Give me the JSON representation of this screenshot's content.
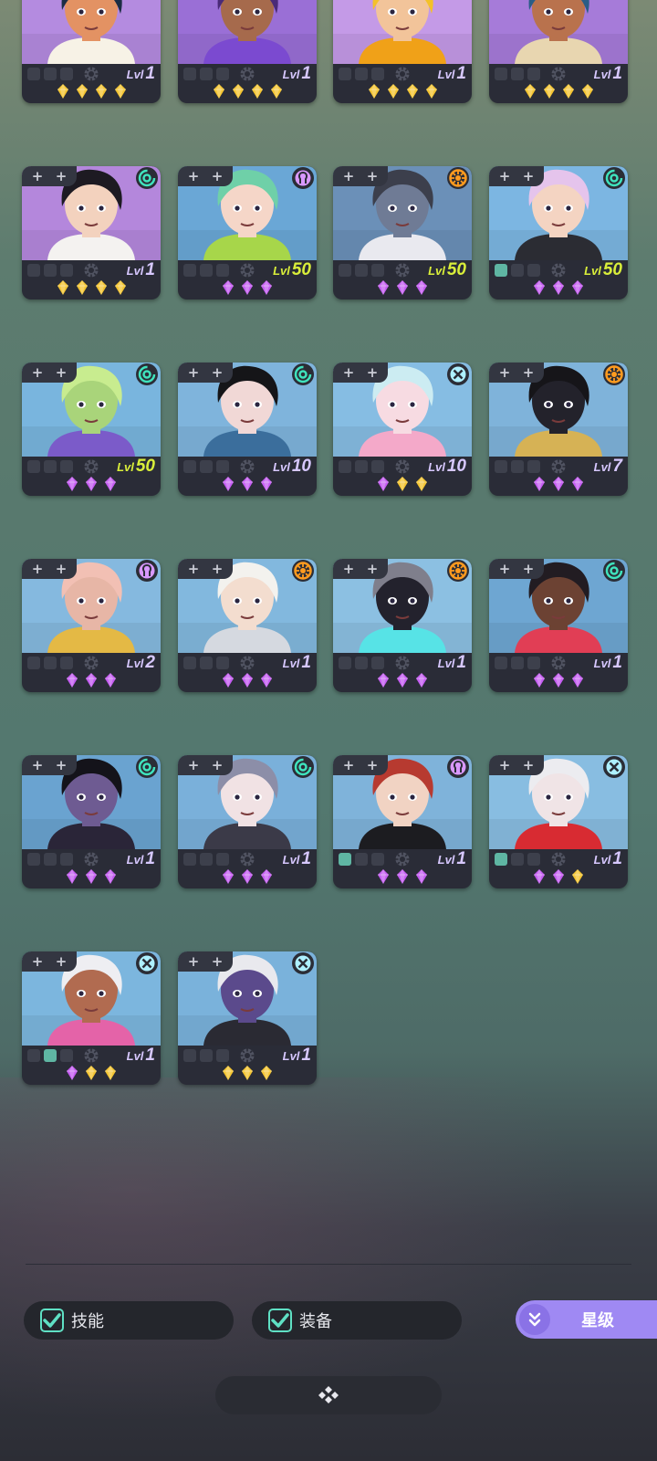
{
  "roster": {
    "heroes": [
      {
        "portrait": "hero-1",
        "bg": "#b48be0",
        "skin": "#e39263",
        "hair": "#1c2d44",
        "accent": "#f7f2e6",
        "slots": [
          false,
          false,
          false
        ],
        "level": "1",
        "elementIcon": "",
        "stars": [
          "gold",
          "gold",
          "gold",
          "gold"
        ]
      },
      {
        "portrait": "hero-2",
        "bg": "#9a6fd6",
        "skin": "#a66a4c",
        "hair": "#4a2a78",
        "accent": "#7b4ad0",
        "slots": [
          false,
          false,
          false
        ],
        "level": "1",
        "elementIcon": "",
        "stars": [
          "gold",
          "gold",
          "gold",
          "gold"
        ]
      },
      {
        "portrait": "hero-3",
        "bg": "#c49ae7",
        "skin": "#f2c49a",
        "hair": "#f3c12a",
        "accent": "#f0a118",
        "slots": [
          false,
          false,
          false
        ],
        "level": "1",
        "elementIcon": "",
        "stars": [
          "gold",
          "gold",
          "gold",
          "gold"
        ]
      },
      {
        "portrait": "hero-4",
        "bg": "#a67bd9",
        "skin": "#b9724d",
        "hair": "#2a5d86",
        "accent": "#e8d6b0",
        "slots": [
          false,
          false,
          false
        ],
        "level": "1",
        "elementIcon": "",
        "stars": [
          "gold",
          "gold",
          "gold",
          "gold"
        ]
      },
      {
        "portrait": "hero-5",
        "bg": "#b487dc",
        "skin": "#f3d2be",
        "hair": "#1d1a22",
        "accent": "#f4f2f0",
        "slots": [
          false,
          false,
          false
        ],
        "level": "1",
        "elementIcon": "swirl-icon",
        "stars": [
          "gold",
          "gold",
          "gold",
          "gold"
        ]
      },
      {
        "portrait": "hero-6",
        "bg": "#6aa7d6",
        "skin": "#f5d6c8",
        "hair": "#6fd0a8",
        "accent": "#a7d64a",
        "slots": [
          false,
          false,
          false
        ],
        "level": "50",
        "elementIcon": "psychic-icon",
        "stars": [
          "purple",
          "purple",
          "purple"
        ]
      },
      {
        "portrait": "hero-7",
        "bg": "#6b90b8",
        "skin": "#6f7b95",
        "hair": "#3c3f4c",
        "accent": "#e9e9ef",
        "slots": [
          false,
          false,
          false
        ],
        "level": "50",
        "elementIcon": "sun-icon",
        "stars": [
          "purple",
          "purple",
          "purple"
        ]
      },
      {
        "portrait": "hero-8",
        "bg": "#7cb6e2",
        "skin": "#f4d4c2",
        "hair": "#e5c4ec",
        "accent": "#2b2c33",
        "slots": [
          true,
          false,
          false
        ],
        "level": "50",
        "elementIcon": "swirl-icon",
        "stars": [
          "purple",
          "purple",
          "purple"
        ]
      },
      {
        "portrait": "hero-9",
        "bg": "#79b5de",
        "skin": "#a9d47a",
        "hair": "#c8ec8f",
        "accent": "#7b5bc9",
        "slots": [
          false,
          false,
          false
        ],
        "level": "50",
        "elementIcon": "swirl-icon",
        "stars": [
          "purple",
          "purple",
          "purple"
        ]
      },
      {
        "portrait": "hero-10",
        "bg": "#7fb4dc",
        "skin": "#f1d8d6",
        "hair": "#151518",
        "accent": "#3b6e9c",
        "slots": [
          false,
          false,
          false
        ],
        "level": "10",
        "elementIcon": "swirl-icon",
        "stars": [
          "purple",
          "purple",
          "purple"
        ]
      },
      {
        "portrait": "hero-11",
        "bg": "#86bde3",
        "skin": "#f7dbe2",
        "hair": "#ccecf2",
        "accent": "#f4a9c9",
        "slots": [
          false,
          false,
          false
        ],
        "level": "10",
        "elementIcon": "cross-icon",
        "stars": [
          "purple",
          "gold",
          "gold"
        ]
      },
      {
        "portrait": "hero-12",
        "bg": "#7fb3da",
        "skin": "#23222b",
        "hair": "#161519",
        "accent": "#d6b255",
        "slots": [
          false,
          false,
          false
        ],
        "level": "7",
        "elementIcon": "sun-icon",
        "stars": [
          "purple",
          "purple",
          "purple"
        ]
      },
      {
        "portrait": "hero-13",
        "bg": "#85b9df",
        "skin": "#e7b6a6",
        "hair": "#f2c0b4",
        "accent": "#e4b945",
        "slots": [
          false,
          false,
          false
        ],
        "level": "2",
        "elementIcon": "psychic-icon",
        "stars": [
          "purple",
          "purple",
          "purple"
        ]
      },
      {
        "portrait": "hero-14",
        "bg": "#82b8de",
        "skin": "#f3ddcf",
        "hair": "#f3f2ee",
        "accent": "#d5d9e0",
        "slots": [
          false,
          false,
          false
        ],
        "level": "1",
        "elementIcon": "sun-icon",
        "stars": [
          "purple",
          "purple",
          "purple"
        ]
      },
      {
        "portrait": "hero-15",
        "bg": "#8cc0e2",
        "skin": "#23222d",
        "hair": "#7f7f8c",
        "accent": "#57e3e6",
        "slots": [
          false,
          false,
          false
        ],
        "level": "1",
        "elementIcon": "sun-icon",
        "stars": [
          "purple",
          "purple",
          "purple"
        ]
      },
      {
        "portrait": "hero-16",
        "bg": "#6ea6d2",
        "skin": "#6c4233",
        "hair": "#221c22",
        "accent": "#e13e55",
        "slots": [
          false,
          false,
          false
        ],
        "level": "1",
        "elementIcon": "swirl-icon",
        "stars": [
          "purple",
          "purple",
          "purple"
        ]
      },
      {
        "portrait": "hero-17",
        "bg": "#6aa3d0",
        "skin": "#6e5b92",
        "hair": "#14131a",
        "accent": "#2a2538",
        "slots": [
          false,
          false,
          false
        ],
        "level": "1",
        "elementIcon": "swirl-icon",
        "stars": [
          "purple",
          "purple",
          "purple"
        ]
      },
      {
        "portrait": "hero-18",
        "bg": "#7ab0da",
        "skin": "#f1e2e4",
        "hair": "#8c8ea8",
        "accent": "#3b3a48",
        "slots": [
          false,
          false,
          false
        ],
        "level": "1",
        "elementIcon": "swirl-icon",
        "stars": [
          "purple",
          "purple",
          "purple"
        ]
      },
      {
        "portrait": "hero-19",
        "bg": "#7fb3da",
        "skin": "#f1d3c3",
        "hair": "#b73a30",
        "accent": "#1c1c20",
        "slots": [
          true,
          false,
          false
        ],
        "level": "1",
        "elementIcon": "psychic-icon",
        "stars": [
          "purple",
          "purple",
          "purple"
        ]
      },
      {
        "portrait": "hero-20",
        "bg": "#88bde1",
        "skin": "#f0e4e6",
        "hair": "#ececf0",
        "accent": "#d82b32",
        "slots": [
          true,
          false,
          false
        ],
        "level": "1",
        "elementIcon": "cross-icon",
        "stars": [
          "purple",
          "purple",
          "gold"
        ]
      },
      {
        "portrait": "hero-21",
        "bg": "#7cb6de",
        "skin": "#b16b50",
        "hair": "#eeeef2",
        "accent": "#e463a8",
        "slots": [
          false,
          true,
          false
        ],
        "level": "1",
        "elementIcon": "cross-icon",
        "stars": [
          "purple",
          "gold",
          "gold"
        ]
      },
      {
        "portrait": "hero-22",
        "bg": "#7ab2db",
        "skin": "#5b4a8c",
        "hair": "#e9e9ee",
        "accent": "#2a2a33",
        "slots": [
          false,
          false,
          false
        ],
        "level": "1",
        "elementIcon": "cross-icon",
        "stars": [
          "gold",
          "gold",
          "gold"
        ]
      }
    ]
  },
  "labels": {
    "level_prefix": "Lvl",
    "slot_plus": "+"
  },
  "filters": {
    "skills": {
      "label": "技能",
      "checked": true
    },
    "equipment": {
      "label": "装备",
      "checked": true
    }
  },
  "sort": {
    "label": "星级"
  },
  "colors": {
    "gold": "#f4c531",
    "purple": "#c55cf2",
    "levelHigh": "#d9ee3a",
    "levelNormal": "#d7c8ff",
    "swirl": "#3fe3bd",
    "psychic": "#d998ff",
    "sun": "#ff9b1f",
    "cross": "#aef0ff",
    "check": "#5fe0c4"
  }
}
